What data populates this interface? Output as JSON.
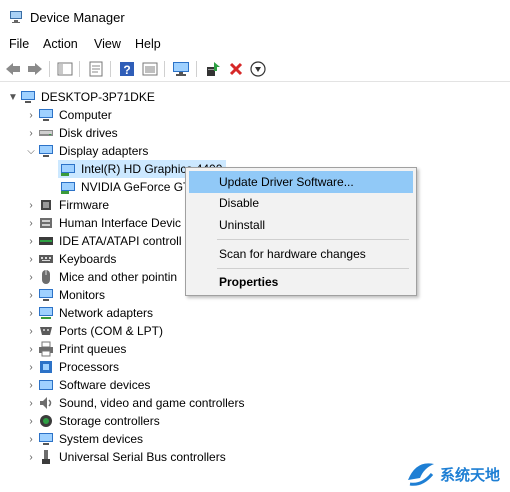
{
  "window": {
    "title": "Device Manager"
  },
  "menu": [
    {
      "label": "File"
    },
    {
      "label": "Action"
    },
    {
      "label": "View"
    },
    {
      "label": "Help"
    }
  ],
  "toolbar": {
    "buttons": [
      "back-icon",
      "forward-icon",
      "show-hide-tree-icon",
      "properties-icon",
      "help-icon",
      "view-icon",
      "monitor-icon",
      "update-driver-icon",
      "uninstall-icon",
      "download-icon"
    ]
  },
  "tree": {
    "root": "DESKTOP-3P71DKE",
    "categories": [
      {
        "label": "Computer",
        "expanded": false
      },
      {
        "label": "Disk drives",
        "expanded": false
      },
      {
        "label": "Display adapters",
        "expanded": true,
        "children": [
          "Intel(R) HD Graphics 4400",
          "NVIDIA GeForce GT"
        ]
      },
      {
        "label": "Firmware",
        "expanded": false
      },
      {
        "label": "Human Interface Devic",
        "expanded": false
      },
      {
        "label": "IDE ATA/ATAPI controll",
        "expanded": false
      },
      {
        "label": "Keyboards",
        "expanded": false
      },
      {
        "label": "Mice and other pointin",
        "expanded": false
      },
      {
        "label": "Monitors",
        "expanded": false
      },
      {
        "label": "Network adapters",
        "expanded": false
      },
      {
        "label": "Ports (COM & LPT)",
        "expanded": false
      },
      {
        "label": "Print queues",
        "expanded": false
      },
      {
        "label": "Processors",
        "expanded": false
      },
      {
        "label": "Software devices",
        "expanded": false
      },
      {
        "label": "Sound, video and game controllers",
        "expanded": false
      },
      {
        "label": "Storage controllers",
        "expanded": false
      },
      {
        "label": "System devices",
        "expanded": false
      },
      {
        "label": "Universal Serial Bus controllers",
        "expanded": false
      }
    ]
  },
  "context_menu": {
    "items": [
      {
        "label": "Update Driver Software...",
        "highlighted": true
      },
      {
        "label": "Disable"
      },
      {
        "label": "Uninstall"
      },
      {
        "label": "Scan for hardware changes"
      },
      {
        "label": "Properties",
        "bold": true
      }
    ]
  },
  "watermark": {
    "text": "系统天地"
  },
  "colors": {
    "selection": "#cce8ff",
    "menu_highlight": "#91c9f7",
    "accent": "#1e7fd4"
  }
}
